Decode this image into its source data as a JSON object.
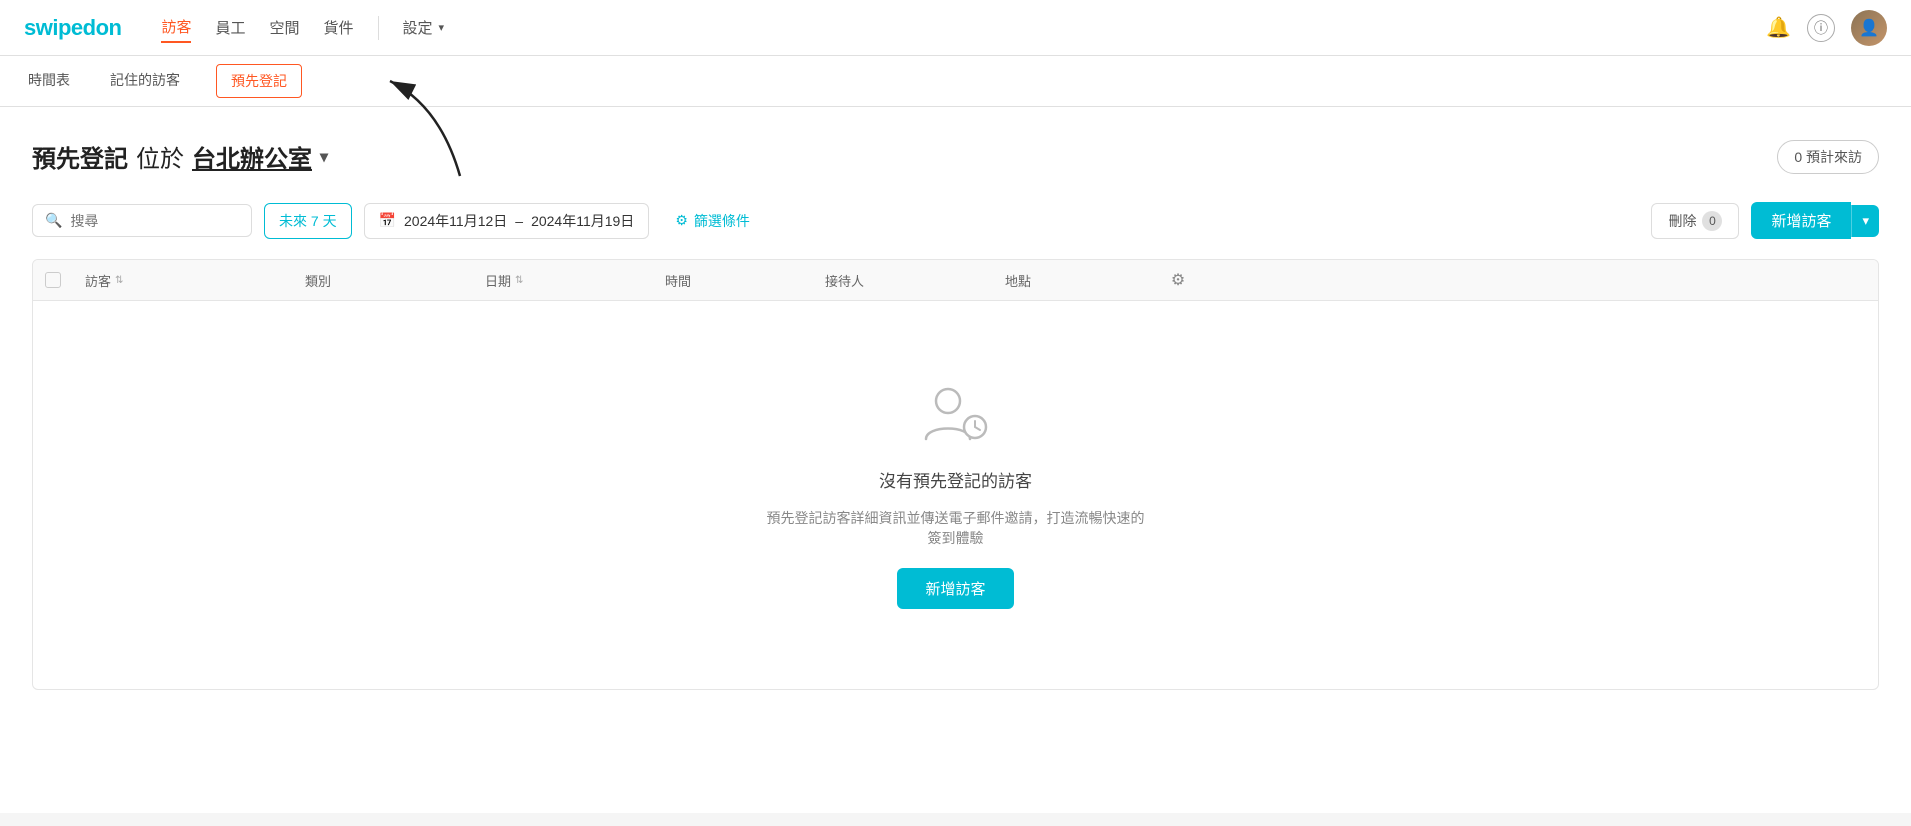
{
  "brand": {
    "name_part1": "swipe",
    "name_part2": "don"
  },
  "navbar": {
    "links": [
      {
        "label": "訪客",
        "active": true
      },
      {
        "label": "員工",
        "active": false
      },
      {
        "label": "空間",
        "active": false
      },
      {
        "label": "貨件",
        "active": false
      }
    ],
    "settings_label": "設定",
    "bell_title": "通知",
    "info_title": "資訊",
    "avatar_label": "使用者頭像"
  },
  "tabs": {
    "items": [
      {
        "label": "時間表",
        "active": false
      },
      {
        "label": "記住的訪客",
        "active": false
      },
      {
        "label": "預先登記",
        "active": true
      }
    ]
  },
  "page": {
    "title": "預先登記",
    "title_at": "位於",
    "location": "台北辦公室",
    "estimated_label": "0 預計來訪"
  },
  "filters": {
    "search_placeholder": "搜尋",
    "quick_filter": "未來 7 天",
    "date_from": "2024年11月12日",
    "date_to": "2024年11月19日",
    "filter_label": "篩選條件",
    "delete_label": "刪除",
    "delete_count": "0",
    "add_visitor_label": "新增訪客"
  },
  "table": {
    "columns": [
      {
        "label": ""
      },
      {
        "label": "訪客",
        "sortable": true
      },
      {
        "label": "類別",
        "sortable": false
      },
      {
        "label": "日期",
        "sortable": true
      },
      {
        "label": "時間",
        "sortable": false
      },
      {
        "label": "接待人",
        "sortable": false
      },
      {
        "label": "地點",
        "sortable": false
      },
      {
        "label": "⚙",
        "sortable": false
      }
    ]
  },
  "empty_state": {
    "title": "沒有預先登記的訪客",
    "description": "預先登記訪客詳細資訊並傳送電子郵件邀請，打造流暢快速的簽到體驗",
    "add_button": "新增訪客"
  }
}
